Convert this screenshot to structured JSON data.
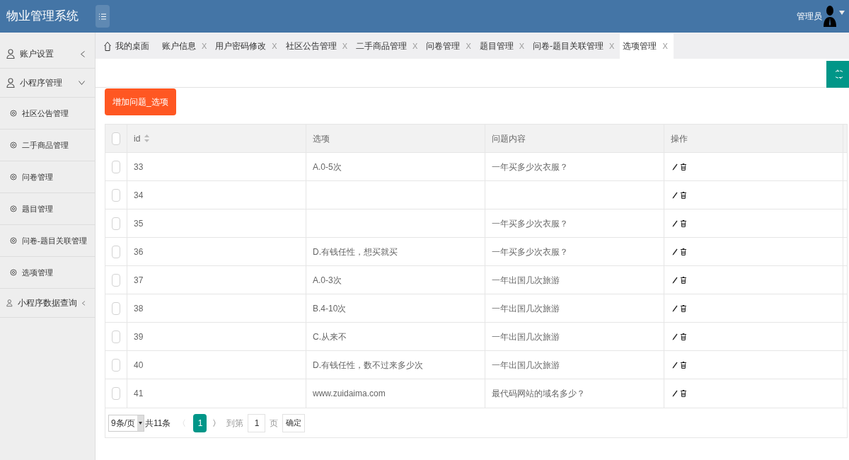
{
  "header": {
    "title": "物业管理系统",
    "user": "管理员"
  },
  "sidebar": {
    "items": [
      {
        "label": "账户设置",
        "expanded": false
      },
      {
        "label": "小程序管理",
        "expanded": true,
        "children": [
          {
            "label": "社区公告管理"
          },
          {
            "label": "二手商品管理"
          },
          {
            "label": "问卷管理"
          },
          {
            "label": "题目管理"
          },
          {
            "label": "问卷-题目关联管理"
          },
          {
            "label": "选项管理"
          }
        ]
      },
      {
        "label": "小程序数据查询",
        "expanded": false
      }
    ]
  },
  "tabs": [
    {
      "label": "我的桌面",
      "kind": "home",
      "selected": false
    },
    {
      "label": "账户信息",
      "kind": "closable",
      "close": "X",
      "selected": false
    },
    {
      "label": "用户密码修改",
      "kind": "closable",
      "close": "X",
      "selected": false
    },
    {
      "label": "社区公告管理",
      "kind": "closable",
      "close": "X",
      "selected": false
    },
    {
      "label": "二手商品管理",
      "kind": "closable",
      "close": "X",
      "selected": false
    },
    {
      "label": "问卷管理",
      "kind": "closable",
      "close": "X",
      "selected": false
    },
    {
      "label": "题目管理",
      "kind": "closable",
      "close": "X",
      "selected": false
    },
    {
      "label": "问卷-题目关联管理",
      "kind": "closable",
      "close": "X",
      "selected": false
    },
    {
      "label": "选项管理",
      "kind": "closable",
      "close": "X",
      "selected": true
    }
  ],
  "add_button": "增加问题_选项",
  "table": {
    "select_all_checked": false,
    "columns": [
      "id",
      "选项",
      "问题内容",
      "操作"
    ],
    "rows": [
      {
        "id": "33",
        "option": "A.0-5次",
        "question": "一年买多少次衣服？",
        "checked": false
      },
      {
        "id": "34",
        "checked": false
      },
      {
        "id": "35",
        "question": "一年买多少次衣服？",
        "checked": false
      },
      {
        "id": "36",
        "option": "D.有钱任性，想买就买",
        "question": "一年买多少次衣服？",
        "checked": false
      },
      {
        "id": "37",
        "option": "A.0-3次",
        "question": "一年出国几次旅游",
        "checked": false
      },
      {
        "id": "38",
        "option": "B.4-10次",
        "question": "一年出国几次旅游",
        "checked": false
      },
      {
        "id": "39",
        "option": "C.从来不",
        "question": "一年出国几次旅游",
        "checked": false
      },
      {
        "id": "40",
        "option": "D.有钱任性，数不过来多少次",
        "question": "一年出国几次旅游",
        "checked": false
      },
      {
        "id": "41",
        "option": "www.zuidaima.com",
        "question": "最代码网站的域名多少？",
        "checked": false
      }
    ]
  },
  "pagination": {
    "page_size": "9条/页",
    "total": "共11条",
    "prev": "〈",
    "pages": [
      {
        "label": "1",
        "selected": true
      }
    ],
    "next": "〉",
    "goto_label": "到第",
    "goto_value": "1",
    "page_unit": "页",
    "confirm": "确定"
  }
}
